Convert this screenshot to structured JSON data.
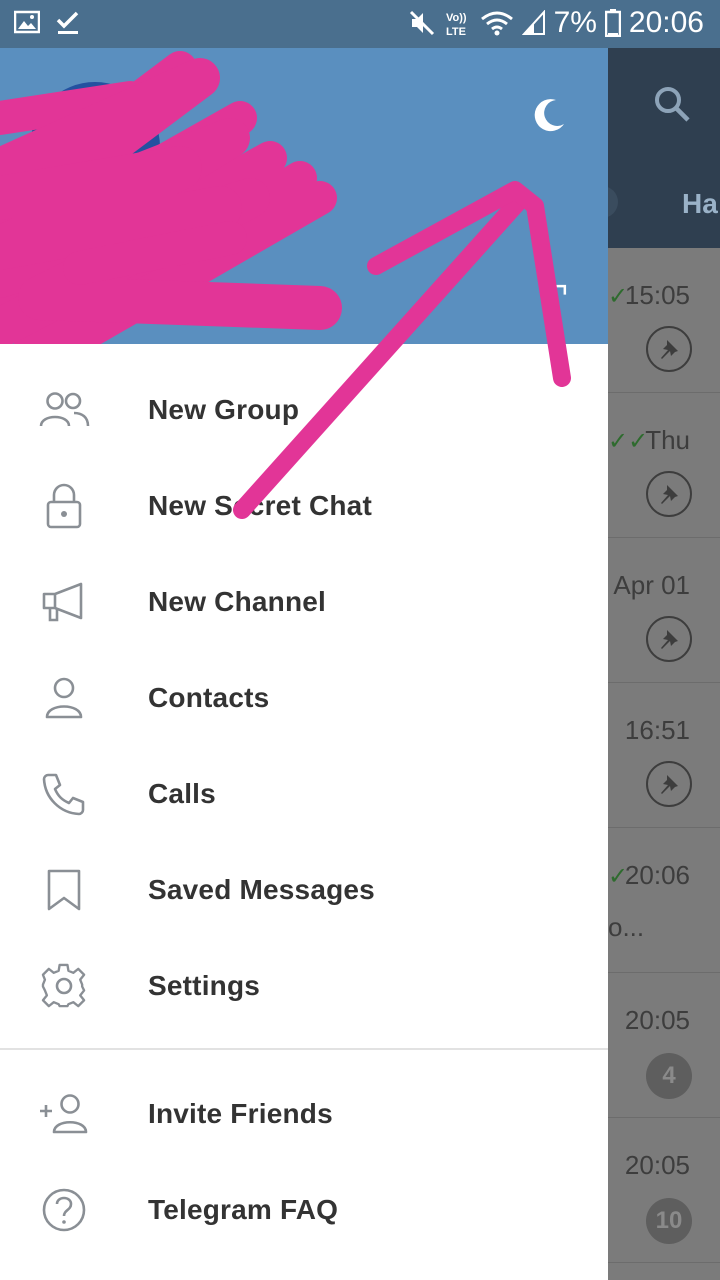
{
  "status_bar": {
    "time": "20:06",
    "battery": "7%",
    "icons": [
      "gallery-icon",
      "checkmark-icon",
      "mute-icon",
      "volte-icon",
      "wifi-icon",
      "signal-icon",
      "battery-icon"
    ],
    "volte_text": "Vo)) LTE"
  },
  "drawer": {
    "header_color": "#5a8fbf",
    "menu": [
      {
        "label": "New Group",
        "icon": "group-icon"
      },
      {
        "label": "New Secret Chat",
        "icon": "lock-icon"
      },
      {
        "label": "New Channel",
        "icon": "megaphone-icon"
      },
      {
        "label": "Contacts",
        "icon": "person-icon"
      },
      {
        "label": "Calls",
        "icon": "phone-icon"
      },
      {
        "label": "Saved Messages",
        "icon": "bookmark-icon"
      },
      {
        "label": "Settings",
        "icon": "gear-icon"
      }
    ],
    "secondary_menu": [
      {
        "label": "Invite Friends",
        "icon": "add-person-icon"
      },
      {
        "label": "Telegram FAQ",
        "icon": "help-icon"
      }
    ]
  },
  "background": {
    "tab_label": "Ha",
    "chats": [
      {
        "time": "15:05",
        "checks": "✓",
        "pinned": true
      },
      {
        "time": "Thu",
        "checks": "✓✓",
        "pinned": true
      },
      {
        "time": "Apr 01",
        "checks": "",
        "pinned": true
      },
      {
        "time": "16:51",
        "checks": "",
        "pinned": true
      },
      {
        "time": "20:06",
        "checks": "✓",
        "preview": "o...",
        "pinned": false
      },
      {
        "time": "20:05",
        "checks": "",
        "badge": "4",
        "pinned": false
      },
      {
        "time": "20:05",
        "checks": "",
        "badge": "10",
        "pinned": false
      }
    ]
  },
  "colors": {
    "status_bar": "#4a6f8e",
    "accent": "#5a8fbf",
    "scribble": "#e23597"
  }
}
